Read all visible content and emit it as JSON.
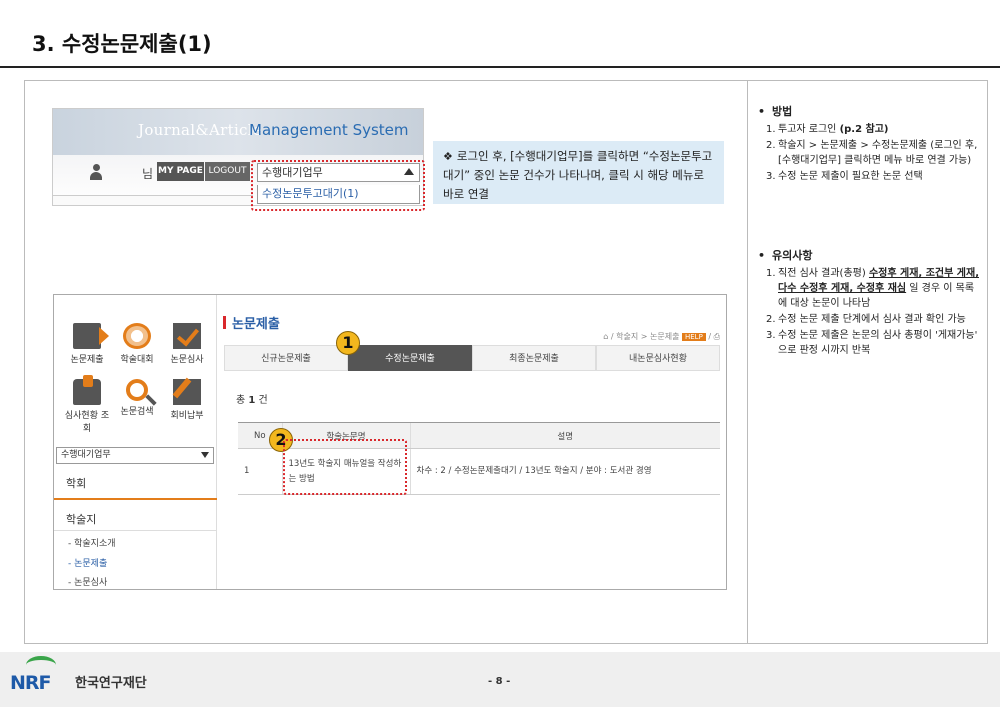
{
  "page": {
    "title": "3. 수정논문제출(1)",
    "page_number": "- 8 -",
    "org_name": "한국연구재단",
    "logo_text": "NRF"
  },
  "header_shot": {
    "brand": "Journal&Article",
    "system": "Management System",
    "user_suffix": "님",
    "mypage": "MY PAGE",
    "logout": "LOGOUT",
    "select_value": "수행대기업무",
    "option": "수정논문투고대기(1)"
  },
  "callout": {
    "bullet": "❖",
    "text": "로그인 후, [수행대기업무]를 클릭하면 “수정논문투고대기” 중인 논문 건수가 나타나며, 클릭 시 해당 메뉴로 바로 연결"
  },
  "main_shot": {
    "sidebar": {
      "icons": [
        {
          "label": "논문제출",
          "icon": "submit-arrow-icon"
        },
        {
          "label": "학술대회",
          "icon": "globe-icon"
        },
        {
          "label": "논문심사",
          "icon": "review-check-icon"
        },
        {
          "label": "심사현황 조회",
          "icon": "status-arrow-icon"
        },
        {
          "label": "논문검색",
          "icon": "search-icon"
        },
        {
          "label": "회비납부",
          "icon": "payment-pencil-icon"
        }
      ],
      "select_value": "수행대기업무",
      "section_1": "학회",
      "section_2": "학술지",
      "links": [
        "- 학술지소개",
        "- 논문제출",
        "- 논문심사"
      ]
    },
    "heading": "논문제출",
    "breadcrumb": "학술지 > 논문제출",
    "help": "HELP",
    "tabs": [
      "신규논문제출",
      "수정논문제출",
      "최종논문제출",
      "내논문심사현황"
    ],
    "count_prefix": "총",
    "count_value": "1",
    "count_suffix": "건",
    "table": {
      "headers": [
        "No",
        "학술논문명",
        "설명"
      ],
      "rows": [
        [
          "1",
          "13년도 학술지 매뉴얼을 작성하는 방법",
          "차수 : 2 / 수정논문제출대기 / 13년도 학술지 / 분야 : 도서관 경영"
        ]
      ]
    },
    "markers": [
      "1",
      "2"
    ]
  },
  "notes": {
    "method": {
      "heading": "방법",
      "items": [
        {
          "num": "1.",
          "text": "투고자 로그인 ",
          "bold": "(p.2 참고)"
        },
        {
          "num": "2.",
          "text": "학술지 > 논문제출 > 수정논문제출 (로그인 후, [수행대기업무] 클릭하면 메뉴 바로 연결 가능)"
        },
        {
          "num": "3.",
          "text": "수정 논문 제출이 필요한 논문 선택"
        }
      ]
    },
    "caution": {
      "heading": "유의사항",
      "item1_pre": "직전 심사 결과(총평) ",
      "item1_u": "수정후 게재, 조건부 게재, 다수 수정후 게재, 수정후 재심",
      "item1_post": " 일 경우 이 목록에 대상 논문이 나타남",
      "item2": "수정 논문 제출 단계에서 심사 결과 확인 가능",
      "item3": "수정 논문 제출은 논문의 심사 총평이 '게재가능' 으로 판정 시까지 반복"
    }
  },
  "colors": {
    "accent_red": "#d9282c",
    "accent_orange": "#e37d1a",
    "link_blue": "#2b5fa6",
    "callout_bg": "#dcebf6",
    "marker_yellow": "#f3b71e"
  }
}
